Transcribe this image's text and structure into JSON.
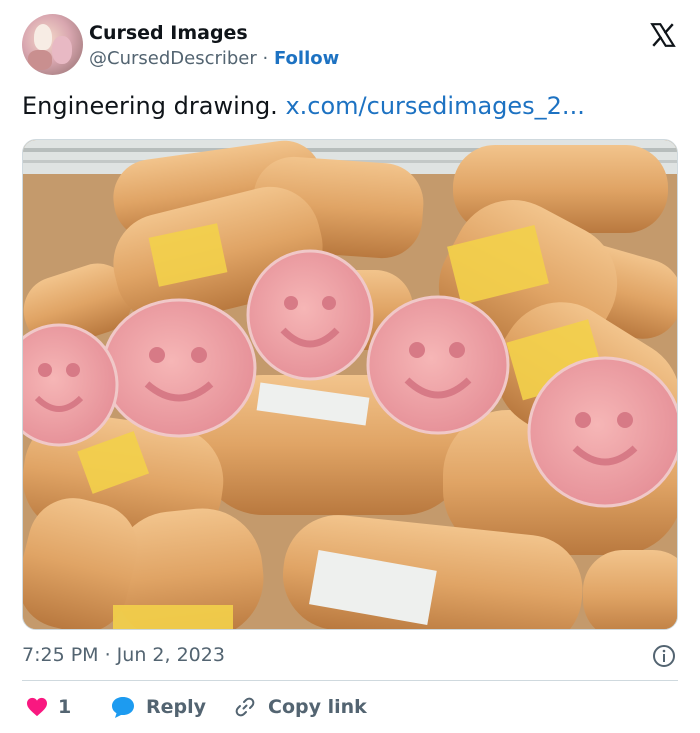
{
  "author": {
    "name": "Cursed Images",
    "handle": "@CursedDescriber",
    "separator": "·",
    "follow_label": "Follow"
  },
  "tweet": {
    "text": "Engineering drawing.",
    "link_text": "x.com/cursedimages_2..."
  },
  "meta": {
    "timestamp": "7:25 PM · Jun 2, 2023"
  },
  "actions": {
    "like_count": "1",
    "reply_label": "Reply",
    "copy_link_label": "Copy link"
  },
  "colors": {
    "link": "#1d72c2",
    "like": "#f91880",
    "reply_icon": "#1d9bf0",
    "muted": "#536471"
  },
  "icons": {
    "platform": "x-logo-icon",
    "info": "info-icon",
    "like": "heart-icon",
    "reply": "speech-bubble-icon",
    "copy": "link-icon"
  }
}
